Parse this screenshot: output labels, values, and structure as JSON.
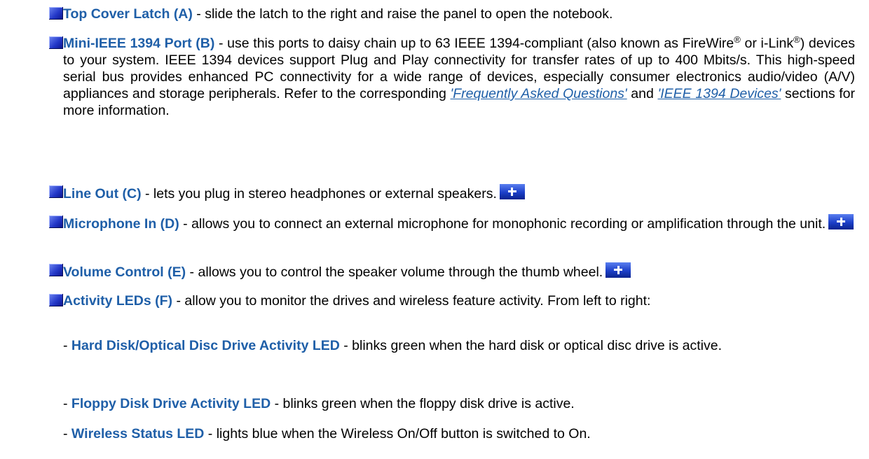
{
  "items": [
    {
      "term": "Top Cover Latch (A)",
      "text": " - slide the latch to the right and raise the panel to open the notebook."
    },
    {
      "term": "Mini-IEEE 1394 Port (B)",
      "text_a": " - use this ports to daisy chain up to 63 IEEE 1394-compliant (also known as FireWire",
      "reg1": "®",
      "text_b": " or i-Link",
      "reg2": "®",
      "text_c": ") devices to your system. IEEE 1394 devices support Plug and Play connectivity for transfer rates of up to 400 Mbits/s. This high-speed serial bus provides enhanced PC connectivity for a wide range of devices, especially consumer electronics audio/video (A/V) appliances and storage peripherals. Refer to the corresponding ",
      "link1": "'Frequently Asked Questions'",
      "text_d": " and ",
      "link2": "'IEEE 1394 Devices'",
      "text_e": " sections for more information."
    },
    {
      "term": "Line Out (C)",
      "text": " - lets you plug in stereo headphones or external speakers."
    },
    {
      "term": "Microphone In (D)",
      "text": " - allows you to connect an external microphone for monophonic recording or amplification through the unit."
    },
    {
      "term": "Volume Control (E)",
      "text": " - allows you to control the speaker volume through the thumb wheel."
    },
    {
      "term": "Activity LEDs (F)",
      "text": " - allow you to monitor the drives and wireless feature activity. From left to right:"
    }
  ],
  "subitems": [
    {
      "prefix": "- ",
      "term": "Hard Disk/Optical Disc Drive Activity LED",
      "text": " - blinks green when the hard disk or optical disc drive is active."
    },
    {
      "prefix": "- ",
      "term": "Floppy Disk Drive Activity LED",
      "text": " - blinks green when the floppy disk drive is active."
    },
    {
      "prefix": "- ",
      "term": "Wireless Status LED",
      "text": " - lights blue when the Wireless On/Off button is switched to On."
    }
  ],
  "icons": {
    "bullet": "blue-square-bullet-icon",
    "more": "plus-icon"
  },
  "colors": {
    "term": "#1f5fa8",
    "bullet": "#2438c8",
    "plus_button": "#1c3fc8"
  }
}
